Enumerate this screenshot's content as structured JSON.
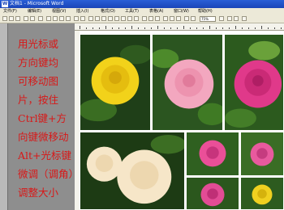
{
  "window": {
    "title": "文档1 - Microsoft Word"
  },
  "menu": {
    "items": [
      "文件(F)",
      "编辑(E)",
      "视图(V)",
      "插入(I)",
      "格式(O)",
      "工具(T)",
      "表格(A)",
      "窗口(W)",
      "帮助(H)"
    ]
  },
  "toolbar": {
    "zoom_value": "75%"
  },
  "instruction": {
    "lines": [
      "用光标或",
      "方向键均",
      "可移动图",
      "片，按住",
      "Ctrl键+方",
      "向键微移动",
      "Alt+光标键",
      "微调（调角）",
      "调整大小"
    ]
  },
  "photos": [
    {
      "name": "yellow-rose",
      "petal_color": "#f2d21a"
    },
    {
      "name": "light-pink-rose",
      "petal_color": "#f3a7bf"
    },
    {
      "name": "magenta-rose",
      "petal_color": "#e0398a"
    },
    {
      "name": "cream-roses",
      "petal_color": "#f6e6c8"
    },
    {
      "name": "small-pink-rose-1",
      "petal_color": "#ea4f98"
    },
    {
      "name": "small-pink-rose-2",
      "petal_color": "#e85a9e"
    },
    {
      "name": "small-pink-rose-3",
      "petal_color": "#e24c95"
    },
    {
      "name": "small-yellow-rose",
      "petal_color": "#f0d020"
    }
  ]
}
